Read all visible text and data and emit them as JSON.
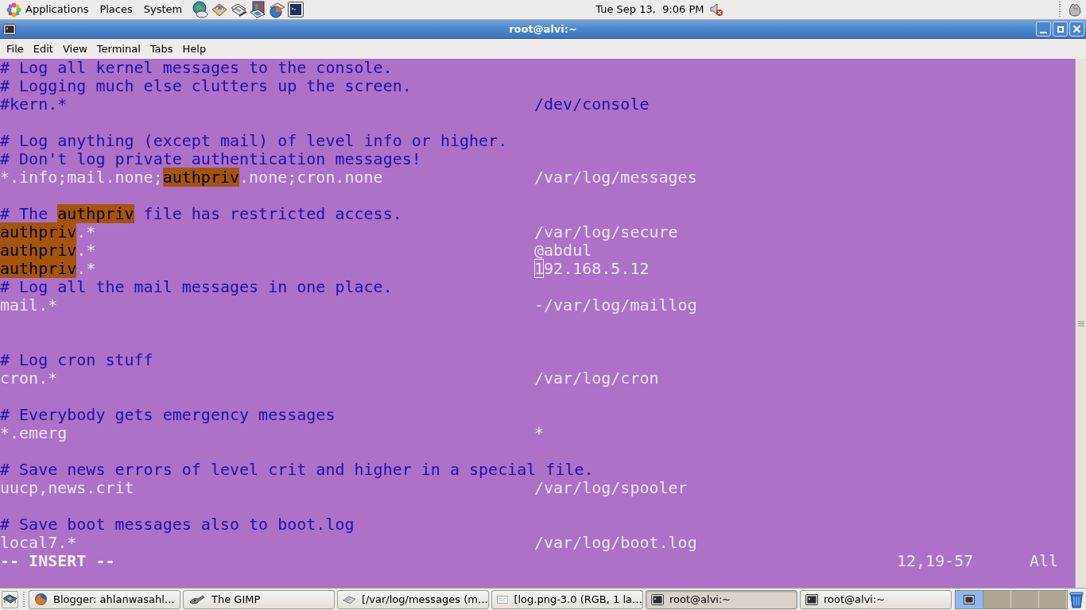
{
  "top_panel": {
    "menus": [
      "Applications",
      "Places",
      "System"
    ],
    "clock": "Tue Sep 13,  9:06 PM"
  },
  "window": {
    "title": "root@alvi:~",
    "menu": [
      "File",
      "Edit",
      "View",
      "Terminal",
      "Tabs",
      "Help"
    ]
  },
  "terminal": {
    "lines": [
      {
        "kind": "comment",
        "selector": "# Log all kernel messages to the console."
      },
      {
        "kind": "comment",
        "selector": "# Logging much else clutters up the screen."
      },
      {
        "kind": "comment",
        "selector": "#kern.*",
        "target": "/dev/console"
      },
      {
        "kind": "blank"
      },
      {
        "kind": "comment",
        "selector": "# Log anything (except mail) of level info or higher."
      },
      {
        "kind": "comment",
        "selector": "# Don't log private authentication messages!"
      },
      {
        "kind": "rule",
        "selector": [
          {
            "text": "*.info;mail.none;",
            "kind": "plain"
          },
          {
            "text": "authpriv",
            "kind": "match"
          },
          {
            "text": ".none;cron.none",
            "kind": "plain"
          }
        ],
        "target": "/var/log/messages"
      },
      {
        "kind": "blank"
      },
      {
        "kind": "comment",
        "selector": [
          {
            "text": "# The ",
            "kind": "plain"
          },
          {
            "text": "authpriv",
            "kind": "match"
          },
          {
            "text": " file has restricted access.",
            "kind": "plain"
          }
        ]
      },
      {
        "kind": "rule",
        "selector": [
          {
            "text": "authpriv",
            "kind": "match"
          },
          {
            "text": ".*",
            "kind": "plain"
          }
        ],
        "target": "/var/log/secure"
      },
      {
        "kind": "rule",
        "selector": [
          {
            "text": "authpriv",
            "kind": "match"
          },
          {
            "text": ".*",
            "kind": "plain"
          }
        ],
        "target": "@abdul"
      },
      {
        "kind": "rule",
        "selector": [
          {
            "text": "authpriv",
            "kind": "match"
          },
          {
            "text": ".*",
            "kind": "plain"
          }
        ],
        "target": [
          {
            "text": "1",
            "kind": "cursor"
          },
          {
            "text": "92.168.5.12",
            "kind": "plain"
          }
        ]
      },
      {
        "kind": "comment",
        "selector": "# Log all the mail messages in one place."
      },
      {
        "kind": "rule",
        "selector": "mail.*",
        "target": "-/var/log/maillog"
      },
      {
        "kind": "blank"
      },
      {
        "kind": "blank"
      },
      {
        "kind": "comment",
        "selector": "# Log cron stuff"
      },
      {
        "kind": "rule",
        "selector": "cron.*",
        "target": "/var/log/cron"
      },
      {
        "kind": "blank"
      },
      {
        "kind": "comment",
        "selector": "# Everybody gets emergency messages"
      },
      {
        "kind": "rule",
        "selector": "*.emerg",
        "target": "*"
      },
      {
        "kind": "blank"
      },
      {
        "kind": "comment",
        "selector": "# Save news errors of level crit and higher in a special file."
      },
      {
        "kind": "rule",
        "selector": "uucp,news.crit",
        "target": "/var/log/spooler"
      },
      {
        "kind": "blank"
      },
      {
        "kind": "comment",
        "selector": "# Save boot messages also to boot.log"
      },
      {
        "kind": "rule",
        "selector": "local7.*",
        "target": "/var/log/boot.log"
      }
    ],
    "status_line": {
      "mode": "-- INSERT --",
      "position": "12,19-57",
      "scroll": "All"
    }
  },
  "taskbar": {
    "tasks": [
      {
        "label": "Blogger: ahlanwasahl…",
        "selected": false
      },
      {
        "label": "The GIMP",
        "selected": false
      },
      {
        "label": "[/var/log/messages (m…",
        "selected": false
      },
      {
        "label": "[log.png-3.0 (RGB, 1 la…",
        "selected": false
      },
      {
        "label": "root@alvi:~",
        "selected": true
      },
      {
        "label": "root@alvi:~",
        "selected": false
      }
    ],
    "workspaces": [
      {
        "selected": true
      },
      {
        "selected": false
      },
      {
        "selected": false
      },
      {
        "selected": false
      }
    ]
  }
}
